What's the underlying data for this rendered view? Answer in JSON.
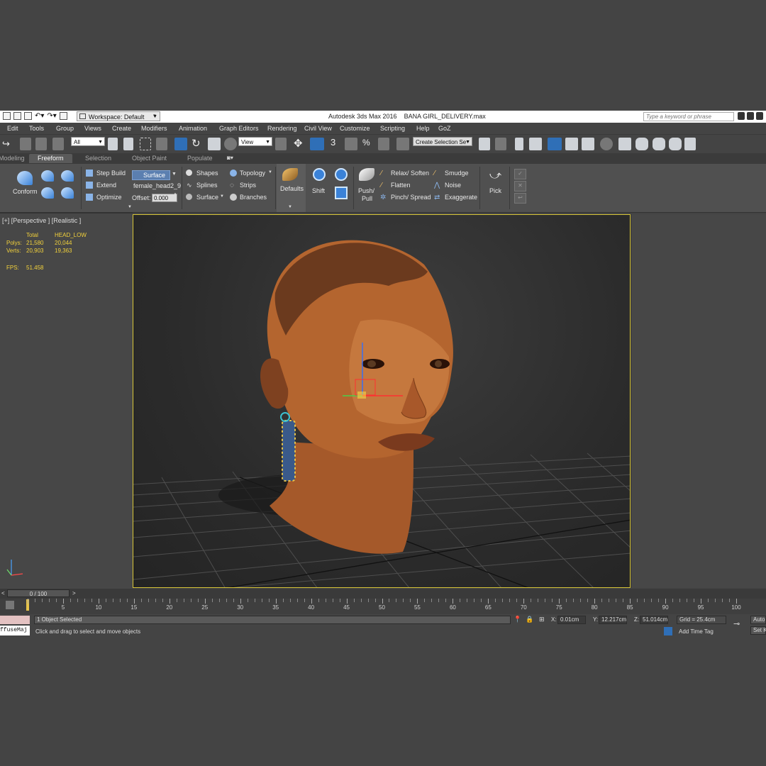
{
  "app": {
    "title": "Autodesk 3ds Max 2016    BANA GIRL_DELIVERY.max",
    "workspace": "Workspace: Default",
    "search_placeholder": "Type a keyword or phrase"
  },
  "menu": [
    "Edit",
    "Tools",
    "Group",
    "Views",
    "Create",
    "Modifiers",
    "Animation",
    "Graph Editors",
    "Rendering",
    "Civil View",
    "Customize",
    "Scripting",
    "Help",
    "GoZ"
  ],
  "toolbar": {
    "selection_filter": "All",
    "reference_coord": "View",
    "named_selection": "Create Selection Se",
    "snap_label": "3"
  },
  "ribbon_tabs": [
    "Modeling",
    "Freeform",
    "Selection",
    "Object Paint",
    "Populate"
  ],
  "ribbon_active_tab": "Freeform",
  "ribbon": {
    "conform": "Conform",
    "step_build": "Step Build",
    "extend": "Extend",
    "optimize": "Optimize",
    "surface_btn": "Surface",
    "object_name": "female_head2_9",
    "offset_label": "Offset:",
    "offset_value": "0.000",
    "shapes": "Shapes",
    "splines": "Splines",
    "surface": "Surface",
    "topology": "Topology",
    "strips": "Strips",
    "branches": "Branches",
    "defaults": "Defaults",
    "shift": "Shift",
    "push_pull_1": "Push/",
    "push_pull_2": "Pull",
    "relax_soften": "Relax/ Soften",
    "flatten": "Flatten",
    "pinch_spread": "Pinch/ Spread",
    "smudge": "Smudge",
    "noise": "Noise",
    "exaggerate": "Exaggerate",
    "pick": "Pick"
  },
  "viewport": {
    "label": "[+] [Perspective ] [Realistic ]",
    "stats": {
      "col_total": "Total",
      "col_object": "HEAD_LOW",
      "polys_label": "Polys:",
      "polys_total": "21,580",
      "polys_obj": "20,044",
      "verts_label": "Verts:",
      "verts_total": "20,903",
      "verts_obj": "19,363",
      "fps_label": "FPS:",
      "fps_value": "51.458"
    }
  },
  "timeline": {
    "frame": "0 / 100",
    "ticks": [
      "5",
      "10",
      "15",
      "20",
      "25",
      "30",
      "35",
      "40",
      "45",
      "50",
      "55",
      "60",
      "65",
      "70",
      "75",
      "80",
      "85",
      "90",
      "95",
      "100"
    ]
  },
  "status": {
    "selection": "1 Object Selected",
    "prompt": "Click and drag to select and move objects",
    "x_label": "X:",
    "x_value": "0.01cm",
    "y_label": "Y:",
    "y_value": "12.217cm",
    "z_label": "Z:",
    "z_value": "51.014cm",
    "grid": "Grid = 25.4cm",
    "add_time_tag": "Add Time Tag",
    "auto": "Auto",
    "set_key": "Set K",
    "maxscript_text": "ffuseMaj"
  }
}
